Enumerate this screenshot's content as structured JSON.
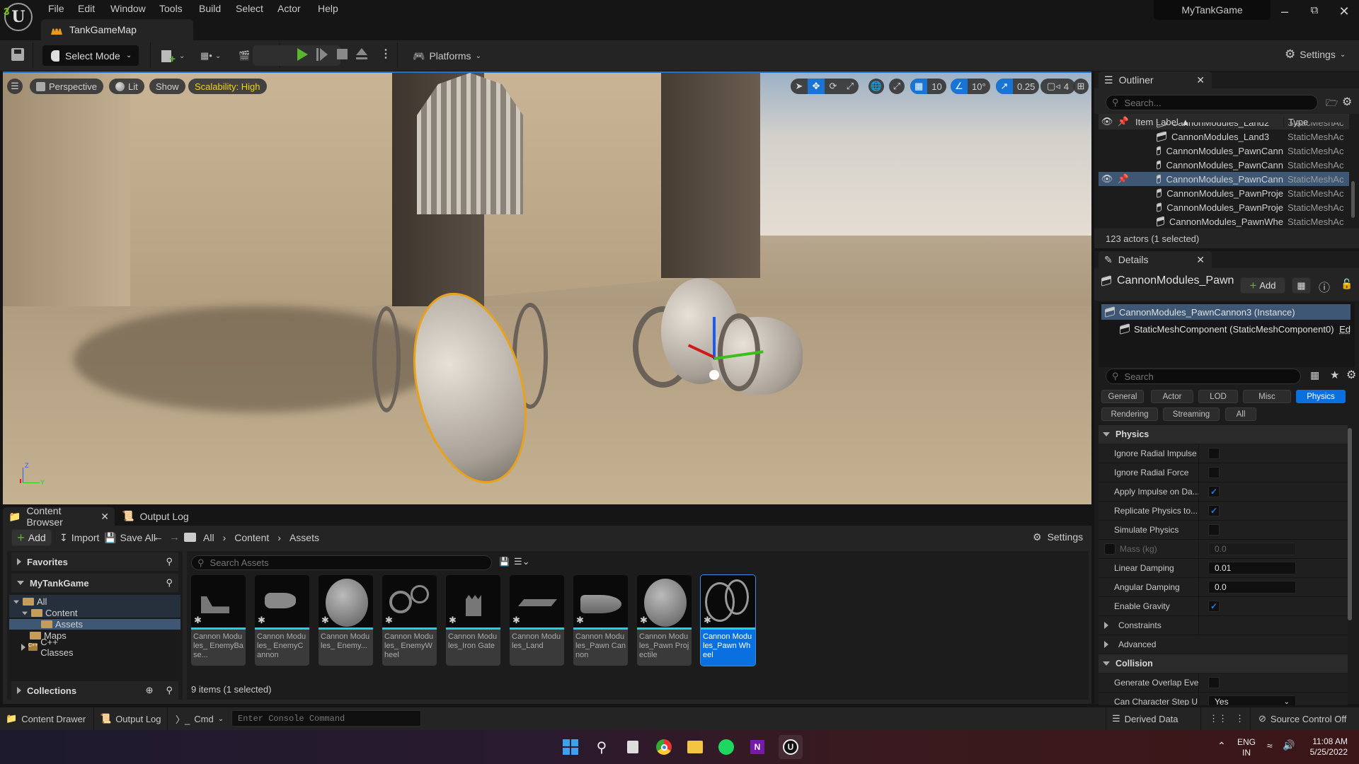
{
  "app": {
    "project_name": "MyTankGame",
    "map_tab": "TankGameMap",
    "menu": [
      "File",
      "Edit",
      "Window",
      "Tools",
      "Build",
      "Select",
      "Actor",
      "Help"
    ]
  },
  "toolbar": {
    "select_mode": "Select Mode",
    "platforms": "Platforms",
    "settings": "Settings"
  },
  "viewport": {
    "view_mode": "Perspective",
    "lighting": "Lit",
    "show": "Show",
    "scalability": "Scalability: High",
    "grid_snap": "10",
    "rotation_snap": "10°",
    "scale_snap": "0.25",
    "camera_speed": "4",
    "accent_color": "#1a74d4",
    "scalability_color": "#f0d020"
  },
  "outliner": {
    "title": "Outliner",
    "search_placeholder": "Search...",
    "col_label": "Item Label",
    "col_type": "Type",
    "rows": [
      {
        "label": "CannonModules_Land2",
        "type": "StaticMeshAc",
        "selected": false
      },
      {
        "label": "CannonModules_Land3",
        "type": "StaticMeshAc",
        "selected": false
      },
      {
        "label": "CannonModules_PawnCann",
        "type": "StaticMeshAc",
        "selected": false
      },
      {
        "label": "CannonModules_PawnCann",
        "type": "StaticMeshAc",
        "selected": false
      },
      {
        "label": "CannonModules_PawnCann",
        "type": "StaticMeshAc",
        "selected": true
      },
      {
        "label": "CannonModules_PawnProje",
        "type": "StaticMeshAc",
        "selected": false
      },
      {
        "label": "CannonModules_PawnProje",
        "type": "StaticMeshAc",
        "selected": false
      },
      {
        "label": "CannonModules_PawnWhe",
        "type": "StaticMeshAc",
        "selected": false
      }
    ],
    "status": "123 actors (1 selected)"
  },
  "details": {
    "title": "Details",
    "actor_name": "CannonModules_Pawn",
    "add_label": "Add",
    "instance_label": "CannonModules_PawnCannon3 (Instance)",
    "component_label": "StaticMeshComponent (StaticMeshComponent0)",
    "edit_link": "Ed",
    "search_placeholder": "Search",
    "filters_row1": [
      "General",
      "Actor",
      "LOD",
      "Misc",
      "Physics"
    ],
    "filters_row2": [
      "Rendering",
      "Streaming",
      "All"
    ],
    "active_filter": "Physics",
    "physics_category": "Physics",
    "properties": [
      {
        "name": "Ignore Radial Impulse",
        "kind": "checkbox",
        "checked": false
      },
      {
        "name": "Ignore Radial Force",
        "kind": "checkbox",
        "checked": false
      },
      {
        "name": "Apply Impulse on Da...",
        "kind": "checkbox",
        "checked": true
      },
      {
        "name": "Replicate Physics to...",
        "kind": "checkbox",
        "checked": true
      },
      {
        "name": "Simulate Physics",
        "kind": "checkbox",
        "checked": false
      },
      {
        "name": "Mass (kg)",
        "kind": "number",
        "value": "0.0",
        "disabled": true
      },
      {
        "name": "Linear Damping",
        "kind": "number",
        "value": "0.01"
      },
      {
        "name": "Angular Damping",
        "kind": "number",
        "value": "0.0"
      },
      {
        "name": "Enable Gravity",
        "kind": "checkbox",
        "checked": true
      }
    ],
    "sub_constraints": "Constraints",
    "sub_advanced": "Advanced",
    "collision_category": "Collision",
    "collision_props": [
      {
        "name": "Generate Overlap Eve...",
        "kind": "checkbox",
        "checked": false
      },
      {
        "name": "Can Character Step U...",
        "kind": "dropdown",
        "value": "Yes"
      }
    ]
  },
  "content_browser": {
    "tab": "Content Browser",
    "output_tab": "Output Log",
    "add": "Add",
    "import": "Import",
    "save_all": "Save All",
    "breadcrumb": [
      "All",
      "Content",
      "Assets"
    ],
    "settings": "Settings",
    "favorites": "Favorites",
    "project": "MyTankGame",
    "tree": [
      {
        "label": "All",
        "level": 0
      },
      {
        "label": "Content",
        "level": 1
      },
      {
        "label": "Assets",
        "level": 2,
        "selected": true
      },
      {
        "label": "Maps",
        "level": 2
      },
      {
        "label": "C++ Classes",
        "level": 1
      }
    ],
    "collections": "Collections",
    "search_placeholder": "Search Assets",
    "assets": [
      {
        "label": "Cannon Modules_ EnemyBase...",
        "thumb": "base"
      },
      {
        "label": "Cannon Modules_ EnemyCannon",
        "thumb": "cannon"
      },
      {
        "label": "Cannon Modules_ Enemy...",
        "thumb": "sphere"
      },
      {
        "label": "Cannon Modules_ EnemyWheel",
        "thumb": "wheel"
      },
      {
        "label": "Cannon Modules_Iron Gate",
        "thumb": "gate"
      },
      {
        "label": "Cannon Modules_Land",
        "thumb": "plane"
      },
      {
        "label": "Cannon Modules_Pawn Cannon",
        "thumb": "barrel"
      },
      {
        "label": "Cannon Modules_Pawn Projectile",
        "thumb": "sphere"
      },
      {
        "label": "Cannon Modules_Pawn Wheel",
        "thumb": "wheel2",
        "selected": true
      }
    ],
    "status": "9 items (1 selected)"
  },
  "statusbar": {
    "content_drawer": "Content Drawer",
    "output_log": "Output Log",
    "cmd": "Cmd",
    "console_placeholder": "Enter Console Command",
    "derived_data": "Derived Data",
    "source_control": "Source Control Off"
  },
  "taskbar": {
    "lang1": "ENG",
    "lang2": "IN",
    "time": "11:08 AM",
    "date": "5/25/2022"
  }
}
